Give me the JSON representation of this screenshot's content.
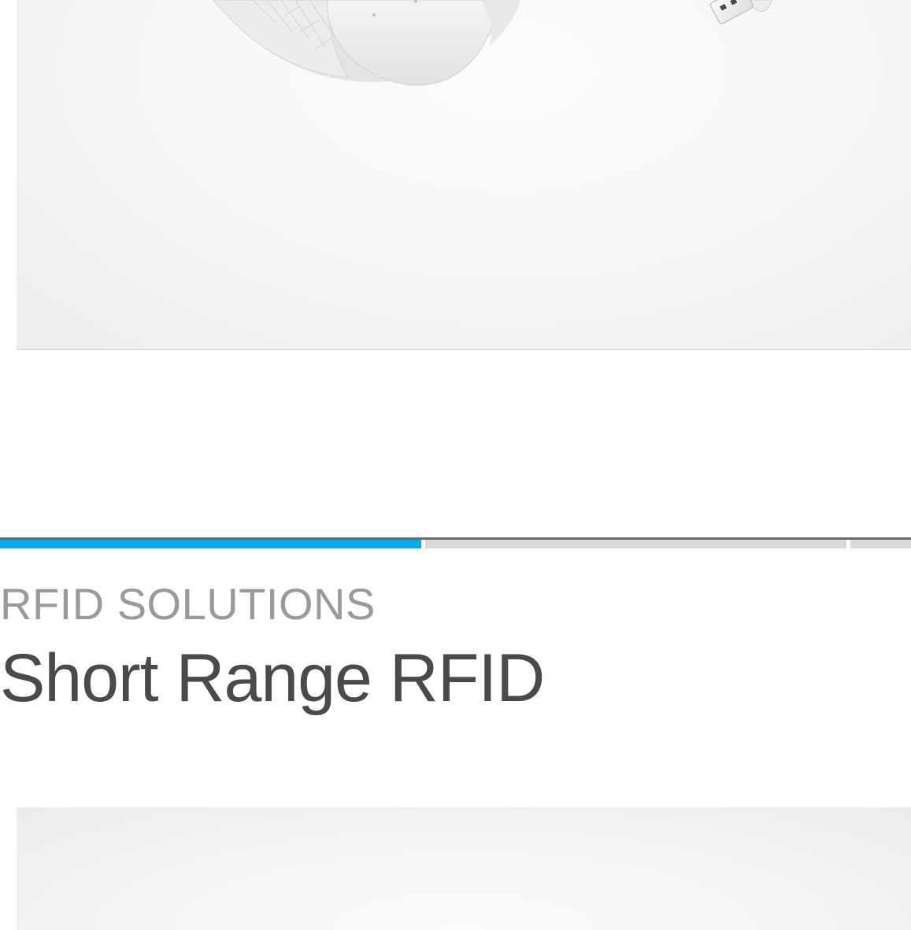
{
  "slider": {
    "slides_total": 3,
    "active_index": 0,
    "accent_color": "#00adee",
    "inactive_color": "#d9d9d9"
  },
  "section": {
    "eyebrow": "RFID SOLUTIONS",
    "title": "Short Range RFID"
  },
  "images": {
    "top": "rfid-reader-product-image",
    "bottom": "product-image"
  }
}
